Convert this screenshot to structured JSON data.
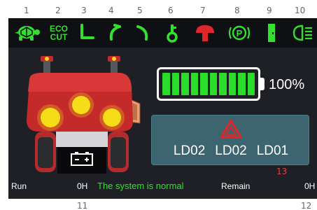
{
  "callouts": [
    "1",
    "2",
    "3",
    "4",
    "5",
    "6",
    "7",
    "8",
    "9",
    "10",
    "11",
    "12",
    "13"
  ],
  "icons": {
    "turtle": "turtle-icon",
    "eco_cut_line1": "ECO",
    "eco_cut_line2": "CUT",
    "seat": "seat-icon",
    "left_turn": "left-turn-icon",
    "right_turn": "right-turn-icon",
    "key": "key-icon",
    "mushroom": "emergency-stop-icon",
    "parking": "parking-brake-icon",
    "door": "door-icon",
    "headlight": "headlight-icon"
  },
  "battery": {
    "level_percent": 100,
    "label": "100%",
    "cell_count": 10
  },
  "fault": {
    "codes": [
      "LD02",
      "LD02",
      "LD01"
    ]
  },
  "status_bar": {
    "run_label": "Run",
    "run_value": "0H",
    "message": "The system is normal",
    "remain_label": "Remain",
    "remain_value": "0H"
  },
  "colors": {
    "status_green": "#2bdc2b",
    "warning_red": "#e0262a",
    "mower_red": "#c42a2a",
    "headlight_yellow": "#f5dd18",
    "screen_bg": "#1e2026",
    "panel_teal": "#3c6570"
  }
}
